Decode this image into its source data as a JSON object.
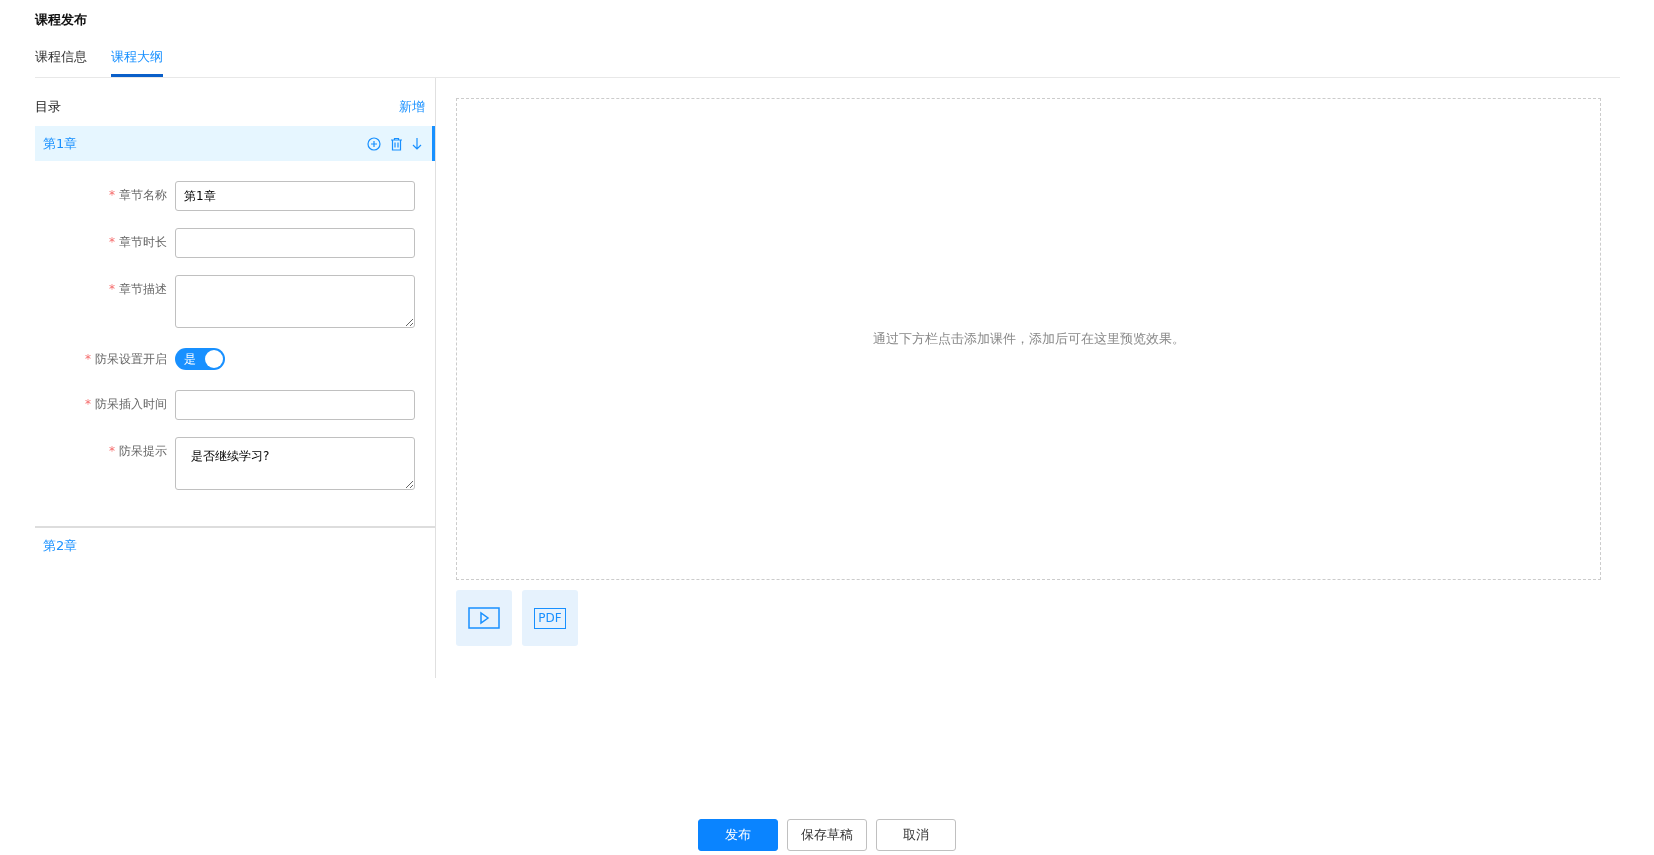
{
  "page_title": "课程发布",
  "tabs": [
    {
      "label": "课程信息",
      "selected": false
    },
    {
      "label": "课程大纲",
      "selected": true
    }
  ],
  "outline": {
    "title": "目录",
    "add_link": "新增",
    "chapters": [
      {
        "title": "第1章",
        "expanded": true,
        "fields": [
          {
            "kind": "input",
            "required_mark": "*",
            "label": "章节名称",
            "value": "第1章"
          },
          {
            "kind": "input",
            "required_mark": "*",
            "label": "章节时长"
          },
          {
            "kind": "textarea",
            "required_mark": "*",
            "label": "章节描述"
          },
          {
            "kind": "switch",
            "required_mark": "*",
            "label": "防呆设置开启",
            "on": true,
            "on_text": "是"
          },
          {
            "kind": "input",
            "required_mark": "*",
            "label": "防呆插入时间"
          },
          {
            "kind": "textarea",
            "required_mark": "*",
            "label": "防呆提示",
            "value": "是否继续学习?"
          }
        ]
      },
      {
        "title": "第2章",
        "expanded": false
      }
    ]
  },
  "preview": {
    "hint": "通过下方栏点击添加课件，添加后可在这里预览效果。",
    "pdf_label": "PDF"
  },
  "buttons": [
    {
      "label": "发布",
      "kind": "primary"
    },
    {
      "label": "保存草稿",
      "kind": "default"
    },
    {
      "label": "取消",
      "kind": "default"
    }
  ]
}
